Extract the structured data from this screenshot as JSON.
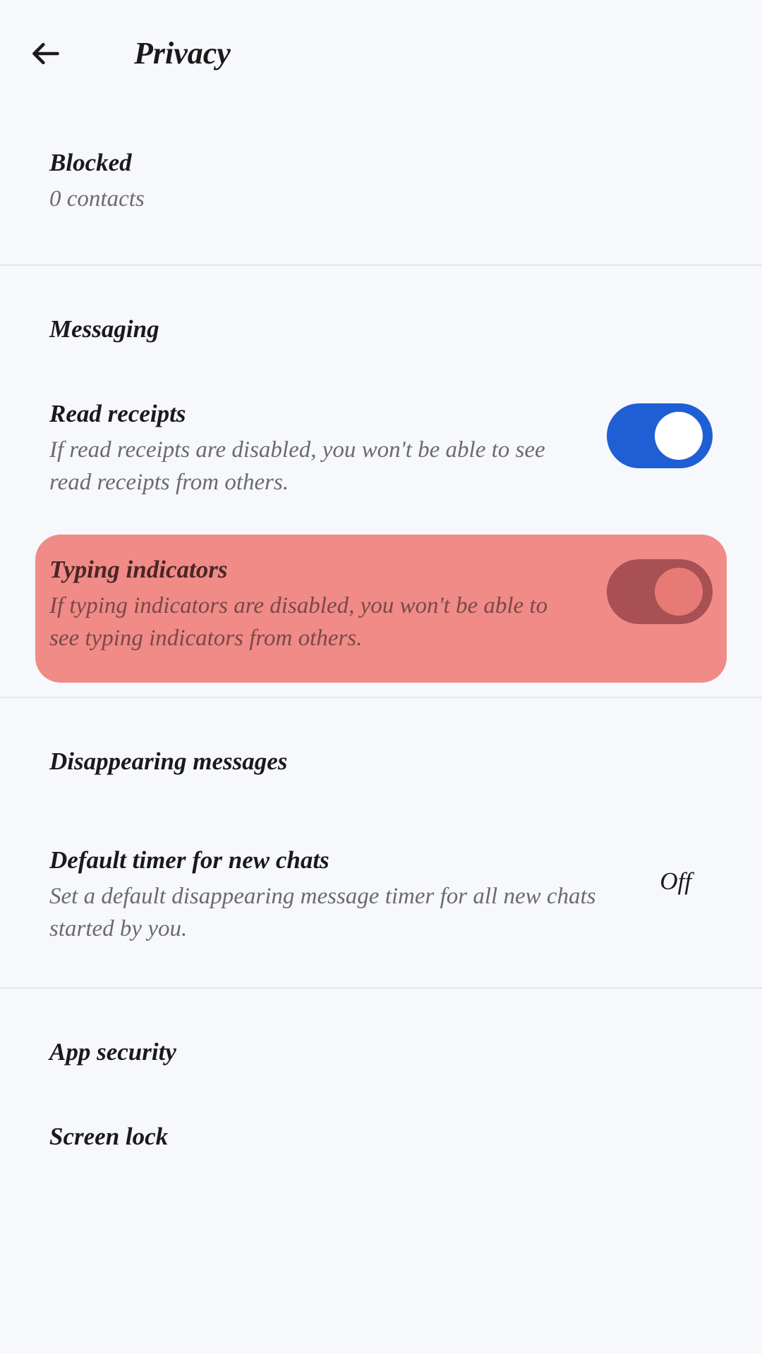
{
  "header": {
    "title": "Privacy"
  },
  "sections": {
    "blocked": {
      "title": "Blocked",
      "subtitle": "0 contacts"
    },
    "messaging": {
      "header": "Messaging",
      "readReceipts": {
        "title": "Read receipts",
        "subtitle": "If read receipts are disabled, you won't be able to see read receipts from others.",
        "enabled": true
      },
      "typingIndicators": {
        "title": "Typing indicators",
        "subtitle": "If typing indicators are disabled, you won't be able to see typing indicators from others.",
        "enabled": true
      }
    },
    "disappearing": {
      "header": "Disappearing messages",
      "defaultTimer": {
        "title": "Default timer for new chats",
        "subtitle": "Set a default disappearing message timer for all new chats started by you.",
        "value": "Off"
      }
    },
    "appSecurity": {
      "header": "App security",
      "screenLock": {
        "title": "Screen lock"
      }
    }
  }
}
